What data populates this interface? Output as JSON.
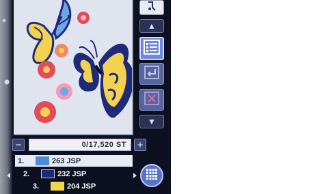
{
  "stitch_counter": {
    "value": "0/17,520 ST",
    "minus_label": "−",
    "plus_label": "+"
  },
  "color_list": [
    {
      "number": "1.",
      "label": "263 JSP",
      "color": "#4f8ad8"
    },
    {
      "number": "2.",
      "label": "232 JSP",
      "color": "#1e2b78"
    },
    {
      "number": "3.",
      "label": "204 JSP",
      "color": "#f2d64a"
    }
  ],
  "side_buttons": {
    "up": "▲",
    "down": "▼"
  },
  "icons": {
    "top": "thread-icon",
    "list": "list-icon",
    "enter": "enter-icon",
    "delete": "delete-icon",
    "grid": "grid-icon"
  },
  "colors": {
    "screen_bg": "#0d1020",
    "button_blue": "#5a73c8",
    "preview_bg": "#dfe4ee"
  }
}
